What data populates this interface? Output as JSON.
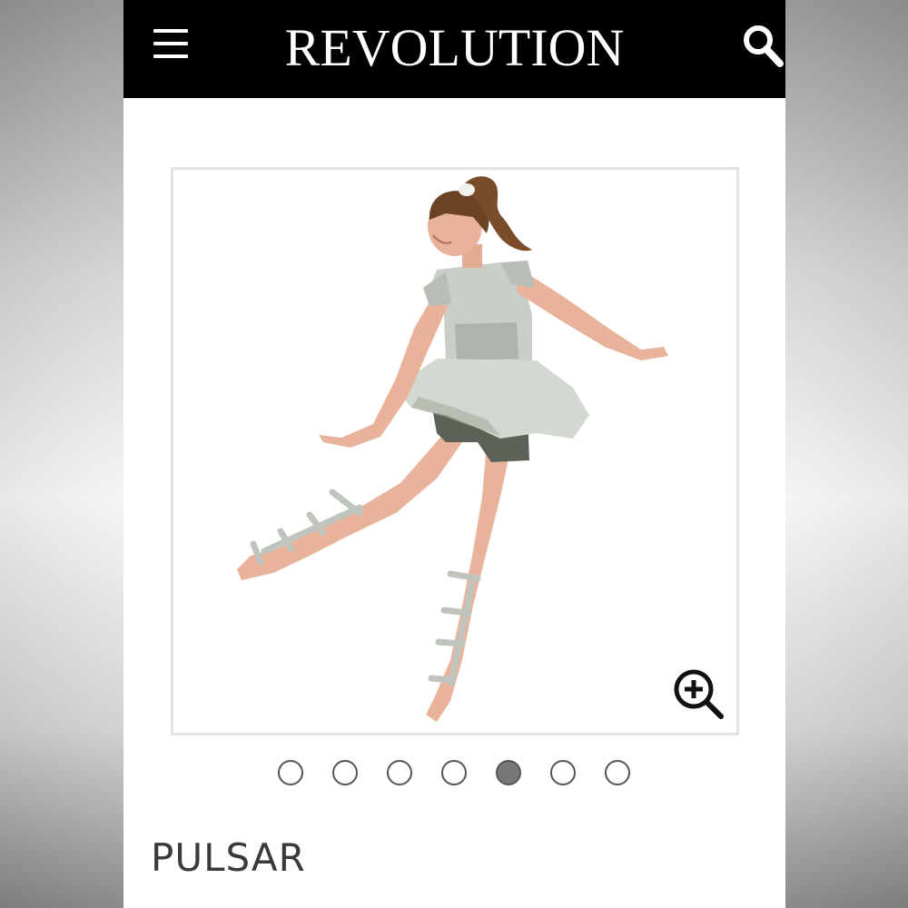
{
  "header": {
    "brand": "REVOLUTION",
    "menu_icon": "hamburger-menu-icon",
    "search_icon": "search-icon",
    "background": "#000000"
  },
  "gallery": {
    "image_subject": "dancer-in-silver-costume",
    "zoom_icon": "zoom-in-icon",
    "slide_count": 7,
    "active_slide": 5
  },
  "product": {
    "title": "PULSAR"
  },
  "colors": {
    "costume_silver": "#c9cfc8",
    "shorts_metallic": "#5d6259",
    "skin": "#e8b39a",
    "hair": "#6b4426"
  }
}
